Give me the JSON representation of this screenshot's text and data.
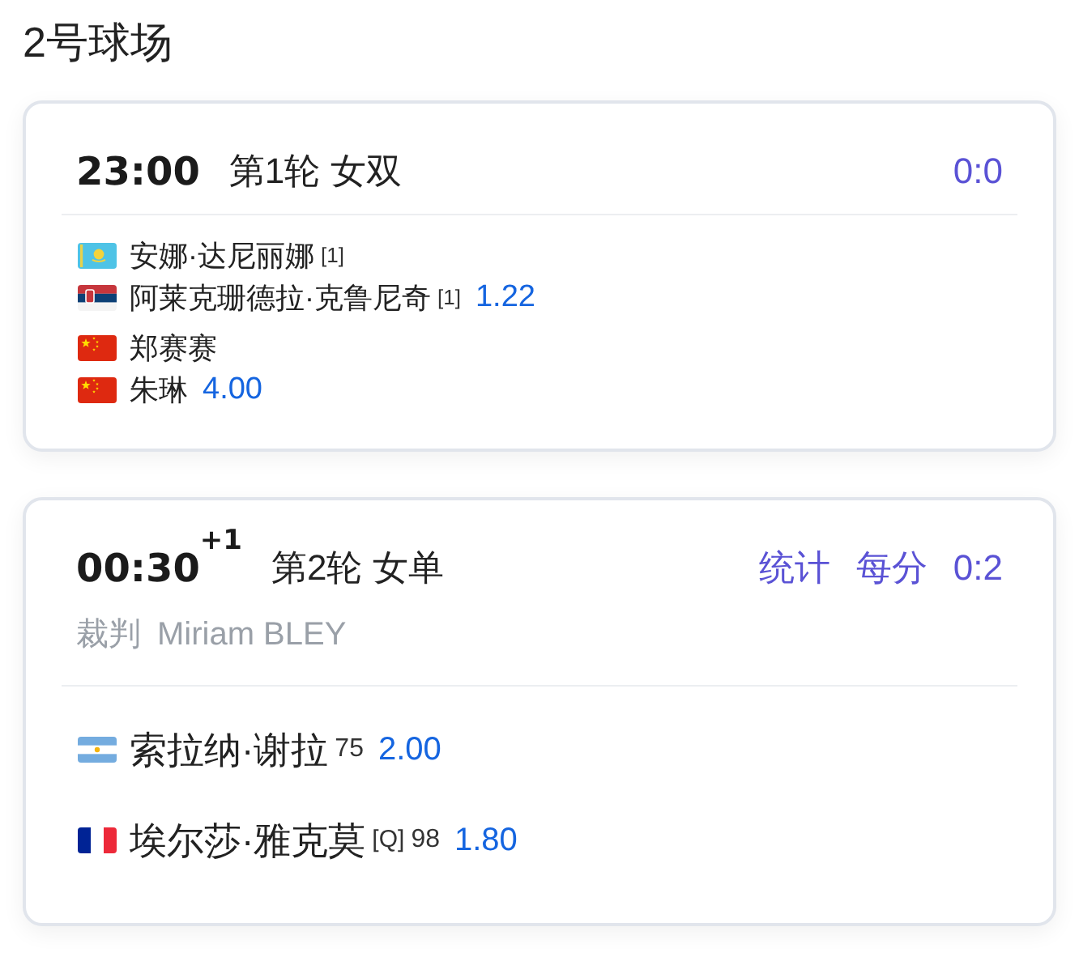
{
  "court": {
    "title": "2号球场"
  },
  "matches": [
    {
      "time": "23:00",
      "round": "第1轮 女双",
      "score": "0:0",
      "teams": [
        {
          "players": [
            {
              "kind": "kazakhstan",
              "name": "安娜·达尼丽娜",
              "seed": "[1]"
            },
            {
              "kind": "serbia",
              "name": "阿莱克珊德拉·克鲁尼奇",
              "seed": "[1]"
            }
          ],
          "odds": "1.22"
        },
        {
          "players": [
            {
              "kind": "china",
              "name": "郑赛赛"
            },
            {
              "kind": "china",
              "name": "朱琳"
            }
          ],
          "odds": "4.00"
        }
      ]
    },
    {
      "time": "00:30",
      "day_offset": "+1",
      "round": "第2轮 女单",
      "links": [
        "统计",
        "每分"
      ],
      "score": "0:2",
      "referee": {
        "label": "裁判",
        "name": "Miriam BLEY"
      },
      "teams": [
        {
          "players": [
            {
              "kind": "argentina",
              "name": "索拉纳·谢拉",
              "rank": "75"
            }
          ],
          "odds": "2.00"
        },
        {
          "players": [
            {
              "kind": "france",
              "name": "埃尔莎·雅克莫",
              "seed": "[Q]",
              "rank": "98"
            }
          ],
          "odds": "1.80"
        }
      ]
    }
  ]
}
